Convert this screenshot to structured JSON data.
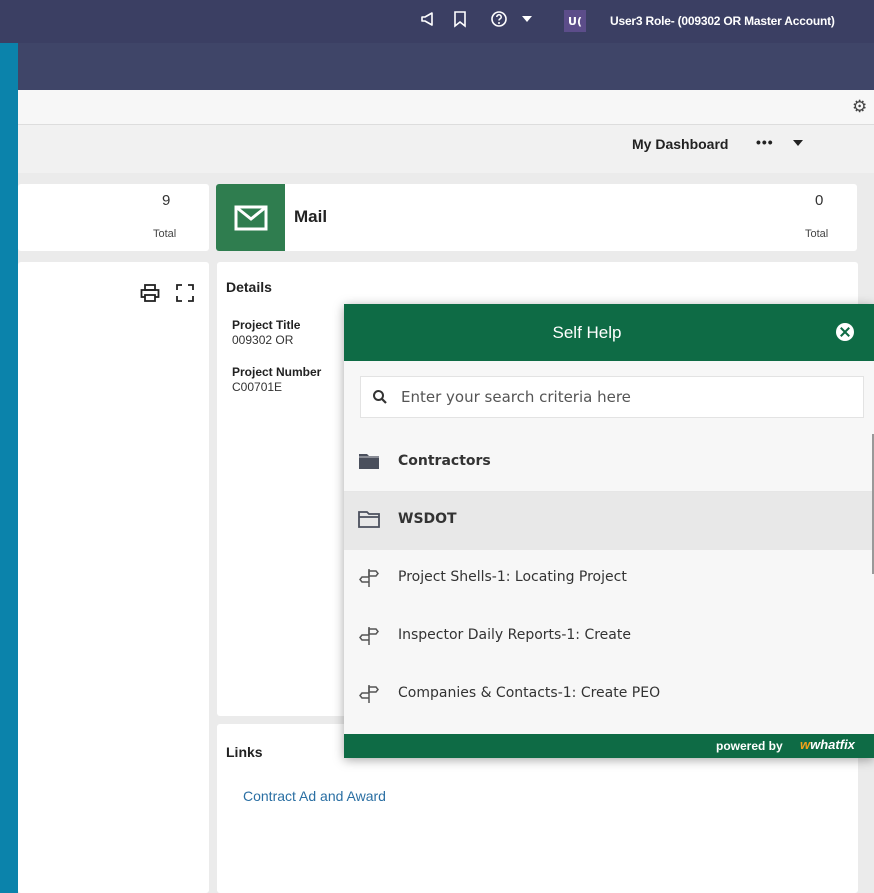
{
  "topbar": {
    "avatar_initials": "U(",
    "user_label": "User3 Role- (009302 OR Master Account)"
  },
  "dashboard": {
    "label": "My Dashboard",
    "more": "•••"
  },
  "summary_card": {
    "count": "9",
    "total_label": "Total"
  },
  "mail_card": {
    "title": "Mail",
    "count": "0",
    "total_label": "Total"
  },
  "details": {
    "title": "Details",
    "fields": [
      {
        "label": "Project Title",
        "value": "009302 OR"
      },
      {
        "label": "Project Number",
        "value": "C00701E"
      }
    ]
  },
  "links": {
    "title": "Links",
    "items": [
      "Contract Ad and Award"
    ]
  },
  "self_help": {
    "title": "Self Help",
    "search_placeholder": "Enter your search criteria here",
    "items": [
      {
        "label": "Contractors",
        "type": "folder"
      },
      {
        "label": "WSDOT",
        "type": "folder-open"
      },
      {
        "label": "Project Shells-1: Locating Project",
        "type": "flow"
      },
      {
        "label": "Inspector Daily Reports-1: Create",
        "type": "flow"
      },
      {
        "label": "Companies & Contacts-1: Create PEO",
        "type": "flow"
      }
    ],
    "powered_by": "powered by",
    "brand": "whatfix",
    "brand_accent": "w"
  },
  "colors": {
    "header": "#3b3f63",
    "selfhelp_green": "#0e6b45",
    "mail_green": "#2f7d4f",
    "link_blue": "#2a6fa3"
  }
}
